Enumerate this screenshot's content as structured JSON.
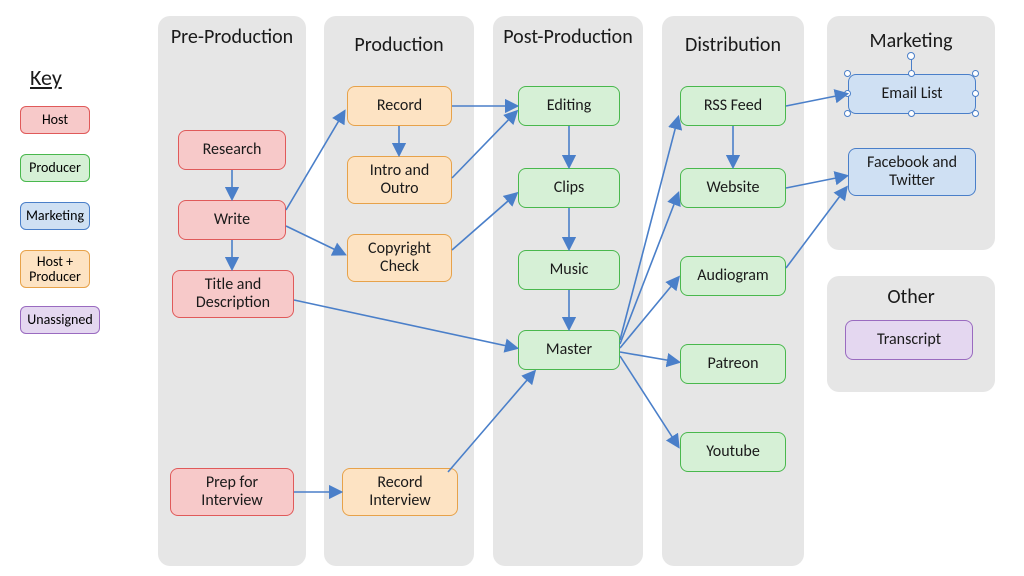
{
  "key": {
    "title": "Key",
    "items": [
      {
        "label": "Host",
        "cls": "host"
      },
      {
        "label": "Producer",
        "cls": "producer"
      },
      {
        "label": "Marketing",
        "cls": "marketing"
      },
      {
        "label": "Host + Producer",
        "cls": "hostprod"
      },
      {
        "label": "Unassigned",
        "cls": "unassigned"
      }
    ]
  },
  "columns": {
    "preprod": {
      "title": "Pre-Production"
    },
    "prod": {
      "title": "Production"
    },
    "postprod": {
      "title": "Post-Production"
    },
    "dist": {
      "title": "Distribution"
    },
    "mkt": {
      "title": "Marketing"
    },
    "other": {
      "title": "Other"
    }
  },
  "nodes": {
    "research": {
      "label": "Research"
    },
    "write": {
      "label": "Write"
    },
    "titledesc": {
      "label": "Title and Description"
    },
    "prepint": {
      "label": "Prep for Interview"
    },
    "record": {
      "label": "Record"
    },
    "introoutro": {
      "label": "Intro and Outro"
    },
    "copyright": {
      "label": "Copyright Check"
    },
    "recordint": {
      "label": "Record Interview"
    },
    "editing": {
      "label": "Editing"
    },
    "clips": {
      "label": "Clips"
    },
    "music": {
      "label": "Music"
    },
    "master": {
      "label": "Master"
    },
    "rssfeed": {
      "label": "RSS Feed"
    },
    "website": {
      "label": "Website"
    },
    "audiogram": {
      "label": "Audiogram"
    },
    "patreon": {
      "label": "Patreon"
    },
    "youtube": {
      "label": "Youtube"
    },
    "emaillist": {
      "label": "Email List"
    },
    "fbtwitter": {
      "label": "Facebook and Twitter"
    },
    "transcript": {
      "label": "Transcript"
    }
  }
}
